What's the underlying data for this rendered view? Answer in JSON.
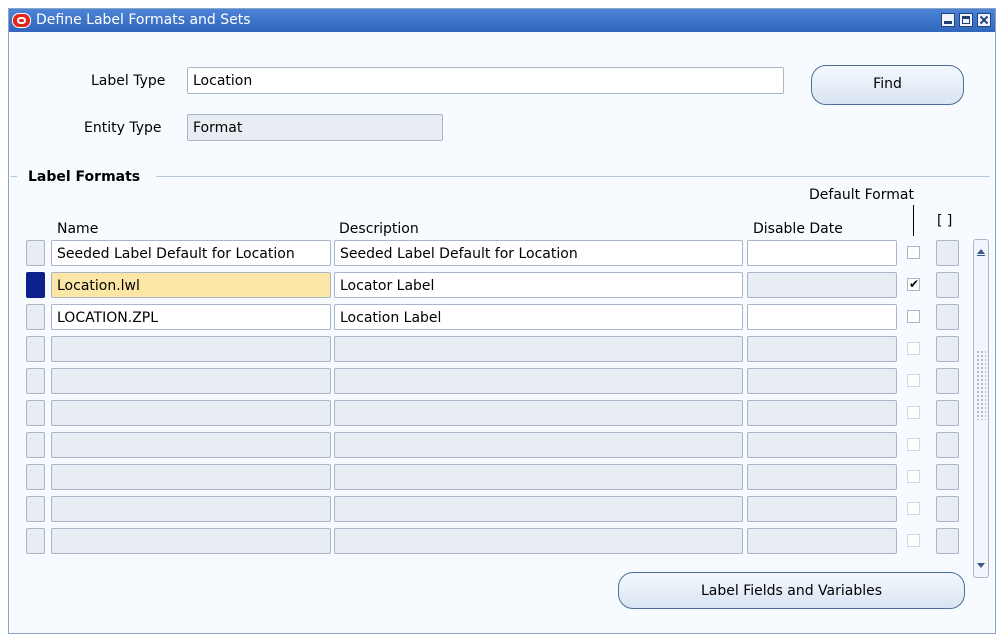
{
  "window": {
    "title": "Define Label Formats and Sets",
    "controls": [
      "minimize-icon",
      "maximize-icon",
      "close-icon"
    ]
  },
  "search": {
    "label_type_label": "Label Type",
    "label_type_value": "Location",
    "entity_type_label": "Entity Type",
    "entity_type_value": "Format",
    "find_button": "Find"
  },
  "label_formats": {
    "section_title": "Label Formats",
    "columns": {
      "name": "Name",
      "description": "Description",
      "disable_date": "Disable Date",
      "default_format": "Default Format",
      "flex": "[ ]"
    },
    "rows": [
      {
        "name": "Seeded Label Default for Location",
        "description": "Seeded Label Default for Location",
        "disable_date": "",
        "default_format": false,
        "current": false
      },
      {
        "name": "Location.lwl",
        "description": "Locator Label",
        "disable_date": "",
        "default_format": true,
        "current": true
      },
      {
        "name": "LOCATION.ZPL",
        "description": "Location Label",
        "disable_date": "",
        "default_format": false,
        "current": false
      },
      {
        "name": "",
        "description": "",
        "disable_date": "",
        "default_format": false,
        "current": false
      },
      {
        "name": "",
        "description": "",
        "disable_date": "",
        "default_format": false,
        "current": false
      },
      {
        "name": "",
        "description": "",
        "disable_date": "",
        "default_format": false,
        "current": false
      },
      {
        "name": "",
        "description": "",
        "disable_date": "",
        "default_format": false,
        "current": false
      },
      {
        "name": "",
        "description": "",
        "disable_date": "",
        "default_format": false,
        "current": false
      },
      {
        "name": "",
        "description": "",
        "disable_date": "",
        "default_format": false,
        "current": false
      },
      {
        "name": "",
        "description": "",
        "disable_date": "",
        "default_format": false,
        "current": false
      }
    ]
  },
  "footer": {
    "label_fields_button": "Label Fields and Variables"
  },
  "colors": {
    "title_bar": "#2f65bb",
    "current_row_indicator": "#0d1f8a",
    "active_field": "#fbe6a5",
    "window_background": "#f7fbff"
  }
}
